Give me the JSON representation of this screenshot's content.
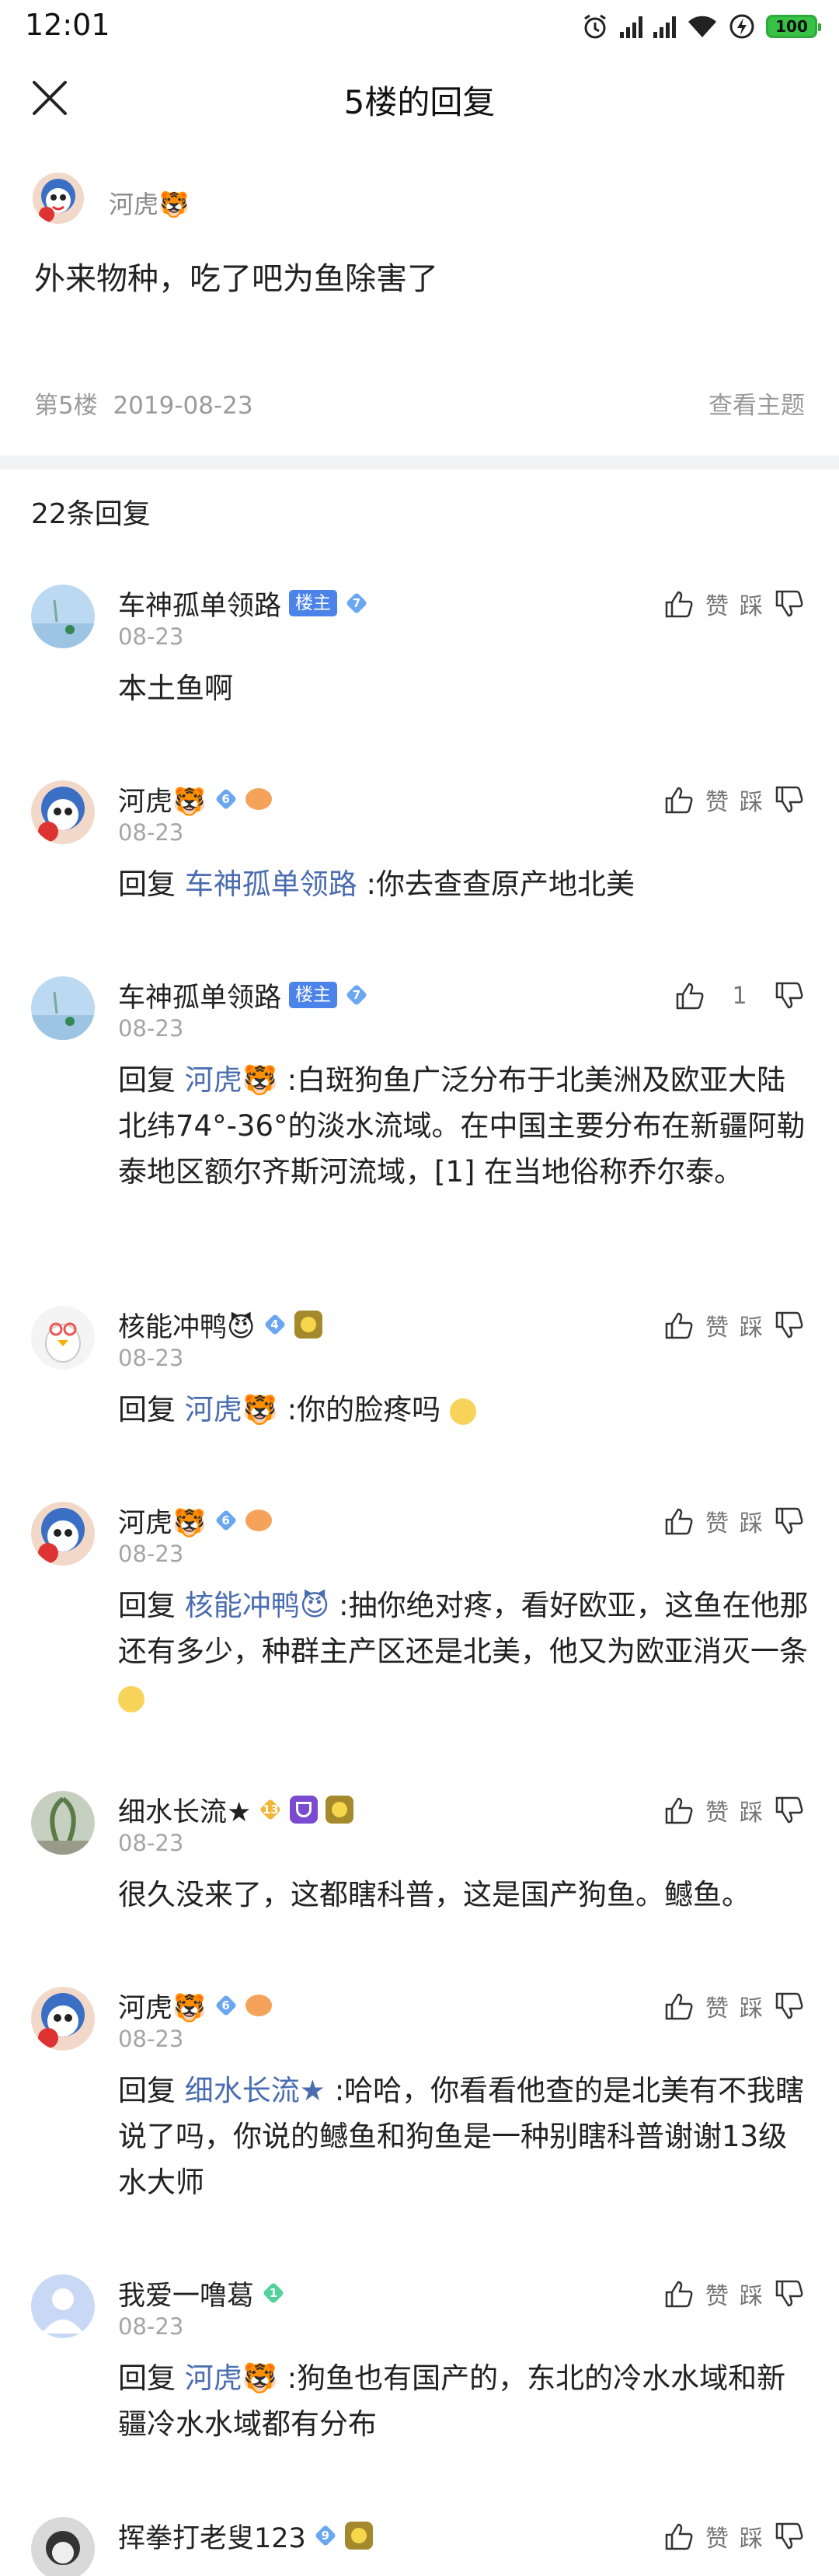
{
  "status_bar": {
    "time": "12:01",
    "battery": "100"
  },
  "header": {
    "title": "5楼的回复"
  },
  "post": {
    "author": "河虎🐯",
    "content": "外来物种，吃了吧为鱼除害了",
    "floor": "第5楼",
    "date": "2019-08-23",
    "view_topic": "查看主题"
  },
  "reply_count": "22条回复",
  "labels": {
    "like": "赞",
    "dislike": "踩",
    "host": "楼主",
    "reply_prefix": "回复"
  },
  "replies": [
    {
      "name": "车神孤单领路",
      "host": true,
      "level": "7",
      "date": "08-23",
      "text": "本土鱼啊",
      "likes": ""
    },
    {
      "name": "河虎🐯",
      "level": "6",
      "date": "08-23",
      "mention": "车神孤单领路",
      "text": ":你去查查原产地北美",
      "likes": ""
    },
    {
      "name": "车神孤单领路",
      "host": true,
      "level": "7",
      "date": "08-23",
      "mention": "河虎🐯",
      "text": ":白斑狗鱼广泛分布于北美洲及欧亚大陆北纬74°-36°的淡水流域。在中国主要分布在新疆阿勒泰地区额尔齐斯河流域，[1] 在当地俗称乔尔泰。",
      "likes": "1"
    },
    {
      "name": "核能冲鸭😈",
      "level": "4",
      "date": "08-23",
      "mention": "河虎🐯",
      "text": ":你的脸疼吗",
      "likes": ""
    },
    {
      "name": "河虎🐯",
      "level": "6",
      "date": "08-23",
      "mention": "核能冲鸭😈",
      "text": ":抽你绝对疼，看好欧亚，这鱼在他那还有多少，种群主产区还是北美，他又为欧亚消灭一条",
      "likes": ""
    },
    {
      "name": "细水长流★",
      "level": "13",
      "date": "08-23",
      "text": "很久没来了，这都瞎科普，这是国产狗鱼。鳡鱼。",
      "likes": ""
    },
    {
      "name": "河虎🐯",
      "level": "6",
      "date": "08-23",
      "mention": "细水长流★",
      "text": ":哈哈，你看看他查的是北美有不我瞎说了吗，你说的鳡鱼和狗鱼是一种别瞎科普谢谢13级水大师",
      "likes": ""
    },
    {
      "name": "我爱一噜葛",
      "level": "1",
      "date": "08-23",
      "mention": "河虎🐯",
      "text": ":狗鱼也有国产的，东北的冷水水域和新疆冷水水域都有分布",
      "likes": ""
    },
    {
      "name": "挥拳打老叟123",
      "level": "9",
      "date": "",
      "text": "",
      "likes": ""
    }
  ]
}
